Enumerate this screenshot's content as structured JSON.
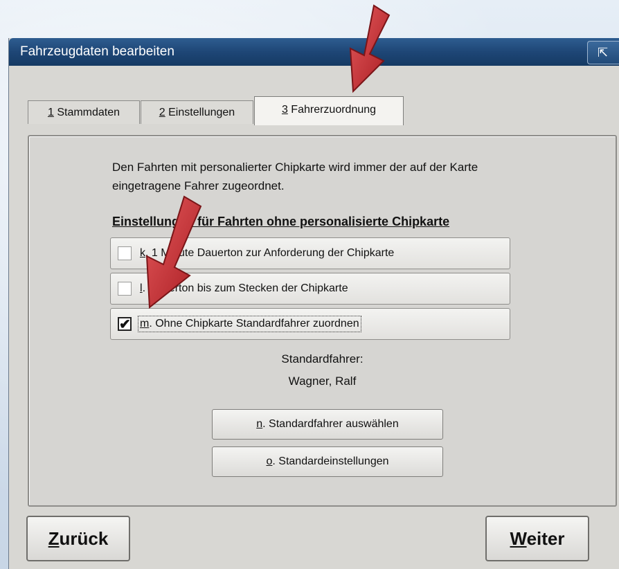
{
  "window": {
    "title": "Fahrzeugdaten bearbeiten",
    "title_button_icon": "⇱"
  },
  "tabs": [
    {
      "num": "1",
      "label": " Stammdaten"
    },
    {
      "num": "2",
      "label": " Einstellungen"
    },
    {
      "num": "3",
      "label": " Fahrerzuordnung"
    }
  ],
  "panel": {
    "info_line1": "Den Fahrten mit personalierter Chipkarte wird immer der auf der Karte",
    "info_line2": "eingetragene Fahrer zugeordnet.",
    "section_heading": "Einstellungen für Fahrten ohne personalisierte Chipkarte",
    "options": [
      {
        "key": "k",
        "label": ". 1 Minute Dauerton zur Anforderung der Chipkarte",
        "checked": false
      },
      {
        "key": "l",
        "label": ". Dauerton bis zum Stecken der Chipkarte",
        "checked": false
      },
      {
        "key": "m",
        "label": ". Ohne Chipkarte Standardfahrer zuordnen",
        "checked": true
      }
    ],
    "standard_driver_label": "Standardfahrer:",
    "standard_driver_name": "Wagner, Ralf",
    "select_driver_key": "n",
    "select_driver_label": ". Standardfahrer auswählen",
    "defaults_key": "o",
    "defaults_label": ". Standardeinstellungen"
  },
  "footer": {
    "back_key": "Z",
    "back_rest": "urück",
    "next_key": "W",
    "next_rest": "eiter"
  },
  "annotation_color": "#c0282d",
  "checkmark": "✔"
}
